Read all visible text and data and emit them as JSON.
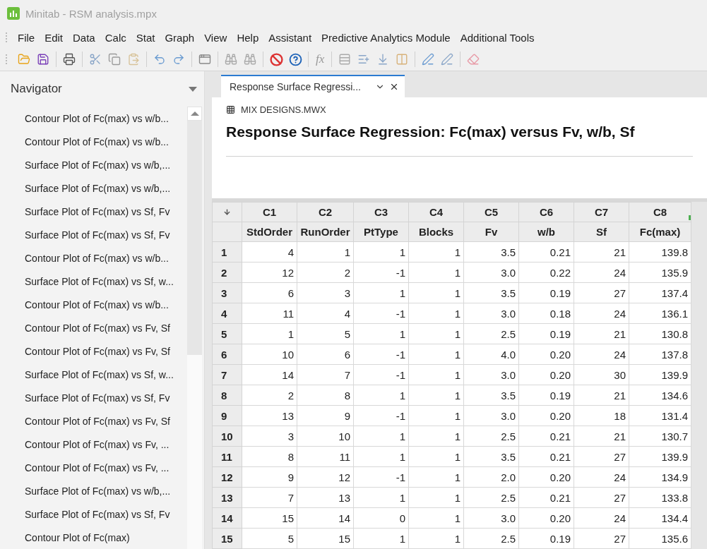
{
  "window": {
    "title": "Minitab - RSM analysis.mpx",
    "active": false
  },
  "menu": [
    "File",
    "Edit",
    "Data",
    "Calc",
    "Stat",
    "Graph",
    "View",
    "Help",
    "Assistant",
    "Predictive Analytics Module",
    "Additional Tools"
  ],
  "toolbar": {
    "function_label": "fx"
  },
  "navigator": {
    "title": "Navigator",
    "items": [
      "Contour Plot of Fc(max) vs w/b...",
      "Contour Plot of Fc(max) vs w/b...",
      "Surface Plot of Fc(max) vs w/b,...",
      "Surface Plot of Fc(max) vs w/b,...",
      "Surface Plot of Fc(max) vs Sf, Fv",
      "Surface Plot of Fc(max) vs Sf, Fv",
      "Contour Plot of Fc(max) vs w/b...",
      "Surface Plot of Fc(max) vs Sf, w...",
      "Contour Plot of Fc(max) vs w/b...",
      "Contour Plot of Fc(max) vs Fv, Sf",
      "Contour Plot of Fc(max) vs Fv, Sf",
      "Surface Plot of Fc(max) vs Sf, w...",
      "Surface Plot of Fc(max) vs Sf, Fv",
      "Contour Plot of Fc(max) vs Fv, Sf",
      "Contour Plot of Fc(max) vs Fv, ...",
      "Contour Plot of Fc(max) vs Fv, ...",
      "Surface Plot of Fc(max) vs w/b,...",
      "Surface Plot of Fc(max) vs Sf, Fv",
      "Contour Plot of Fc(max)"
    ]
  },
  "tabs": [
    {
      "label": "Response Surface Regressi...",
      "selected": true
    }
  ],
  "output": {
    "worksheet": "MIX DESIGNS.MWX",
    "heading": "Response Surface Regression: Fc(max) versus Fv, w/b, Sf"
  },
  "worksheet": {
    "columns": [
      {
        "id": "C1",
        "name": "StdOrder"
      },
      {
        "id": "C2",
        "name": "RunOrder"
      },
      {
        "id": "C3",
        "name": "PtType"
      },
      {
        "id": "C4",
        "name": "Blocks"
      },
      {
        "id": "C5",
        "name": "Fv"
      },
      {
        "id": "C6",
        "name": "w/b"
      },
      {
        "id": "C7",
        "name": "Sf"
      },
      {
        "id": "C8",
        "name": "Fc(max)"
      }
    ],
    "rows": [
      {
        "number": "1",
        "cells": [
          "4",
          "1",
          "1",
          "1",
          "3.5",
          "0.21",
          "21",
          "139.8"
        ]
      },
      {
        "number": "2",
        "cells": [
          "12",
          "2",
          "-1",
          "1",
          "3.0",
          "0.22",
          "24",
          "135.9"
        ]
      },
      {
        "number": "3",
        "cells": [
          "6",
          "3",
          "1",
          "1",
          "3.5",
          "0.19",
          "27",
          "137.4"
        ]
      },
      {
        "number": "4",
        "cells": [
          "11",
          "4",
          "-1",
          "1",
          "3.0",
          "0.18",
          "24",
          "136.1"
        ]
      },
      {
        "number": "5",
        "cells": [
          "1",
          "5",
          "1",
          "1",
          "2.5",
          "0.19",
          "21",
          "130.8"
        ]
      },
      {
        "number": "6",
        "cells": [
          "10",
          "6",
          "-1",
          "1",
          "4.0",
          "0.20",
          "24",
          "137.8"
        ]
      },
      {
        "number": "7",
        "cells": [
          "14",
          "7",
          "-1",
          "1",
          "3.0",
          "0.20",
          "30",
          "139.9"
        ]
      },
      {
        "number": "8",
        "cells": [
          "2",
          "8",
          "1",
          "1",
          "3.5",
          "0.19",
          "21",
          "134.6"
        ]
      },
      {
        "number": "9",
        "cells": [
          "13",
          "9",
          "-1",
          "1",
          "3.0",
          "0.20",
          "18",
          "131.4"
        ]
      },
      {
        "number": "10",
        "cells": [
          "3",
          "10",
          "1",
          "1",
          "2.5",
          "0.21",
          "21",
          "130.7"
        ]
      },
      {
        "number": "11",
        "cells": [
          "8",
          "11",
          "1",
          "1",
          "3.5",
          "0.21",
          "27",
          "139.9"
        ]
      },
      {
        "number": "12",
        "cells": [
          "9",
          "12",
          "-1",
          "1",
          "2.0",
          "0.20",
          "24",
          "134.9"
        ]
      },
      {
        "number": "13",
        "cells": [
          "7",
          "13",
          "1",
          "1",
          "2.5",
          "0.21",
          "27",
          "133.8"
        ]
      },
      {
        "number": "14",
        "cells": [
          "15",
          "14",
          "0",
          "1",
          "3.0",
          "0.20",
          "24",
          "134.4"
        ]
      },
      {
        "number": "15",
        "cells": [
          "5",
          "15",
          "1",
          "1",
          "2.5",
          "0.19",
          "27",
          "135.6"
        ]
      }
    ]
  }
}
